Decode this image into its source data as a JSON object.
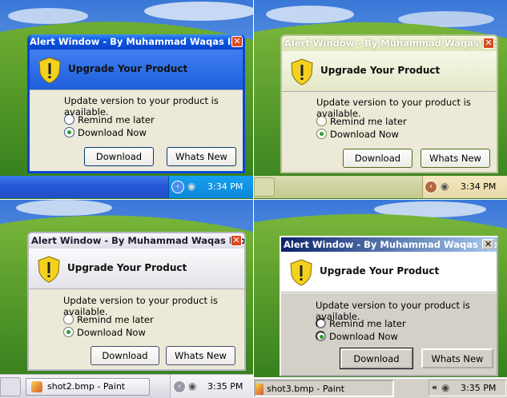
{
  "alert": {
    "title": "Alert Window - By Muhammad Waqas Iqbal",
    "heading": "Upgrade Your Product",
    "message": "Update version to your product is available.",
    "option_remind": "Remind me later",
    "option_download": "Download Now",
    "button_download": "Download",
    "button_whats_new": "Whats New",
    "close_glyph": "✕"
  },
  "panels": [
    {
      "theme": "luna-blue",
      "clock": "3:34 PM",
      "task": ""
    },
    {
      "theme": "luna-olive",
      "clock": "3:34 PM",
      "task": ""
    },
    {
      "theme": "luna-silver",
      "clock": "3:35 PM",
      "task": "shot2.bmp - Paint"
    },
    {
      "theme": "classic",
      "clock": "3:35 PM",
      "task": "shot3.bmp - Paint"
    }
  ],
  "colors": {
    "blue_title": "#0a54e4",
    "olive_title": "#e9ecc9",
    "silver_title": "#e3e3ea",
    "classic_title": "#0a246a",
    "taskbar_blue": "#2a63e0",
    "taskbar_olive": "#c8cf95",
    "taskbar_silver": "#e6e6ea",
    "taskbar_classic": "#d4d0c8"
  },
  "icons": {
    "warning": "shield-warning-icon",
    "close": "close-icon",
    "speaker": "speaker-icon",
    "chevron": "chevron-left-icon",
    "paint": "paint-icon"
  }
}
